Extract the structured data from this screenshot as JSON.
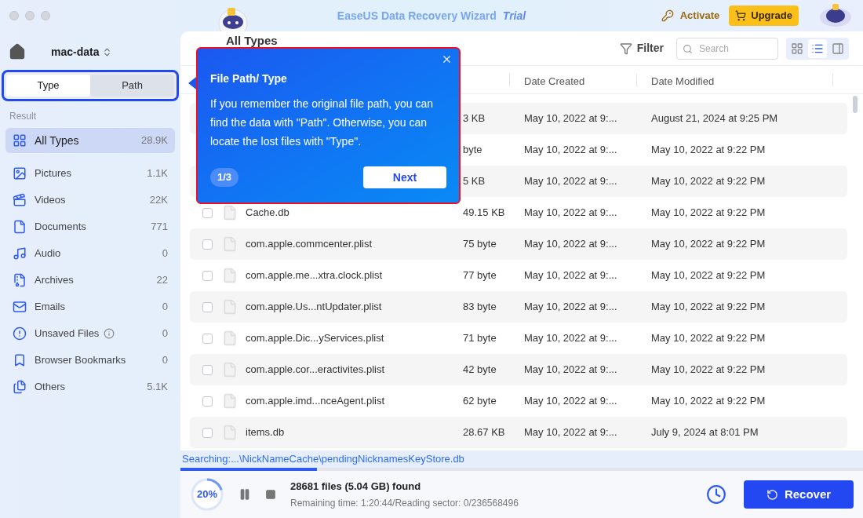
{
  "window": {
    "app_name": "EaseUS Data Recovery Wizard",
    "edition": "Trial"
  },
  "header": {
    "activate": "Activate",
    "upgrade": "Upgrade"
  },
  "sidebar": {
    "device": "mac-data",
    "tabs": [
      {
        "label": "Type",
        "selected": true
      },
      {
        "label": "Path",
        "selected": false
      }
    ],
    "section": "Result",
    "items": [
      {
        "kind": "all",
        "label": "All Types",
        "count": "28.9K",
        "selected": true,
        "info": false
      },
      {
        "kind": "pictures",
        "label": "Pictures",
        "count": "1.1K",
        "selected": false,
        "info": false
      },
      {
        "kind": "videos",
        "label": "Videos",
        "count": "22K",
        "selected": false,
        "info": false
      },
      {
        "kind": "documents",
        "label": "Documents",
        "count": "771",
        "selected": false,
        "info": false
      },
      {
        "kind": "audio",
        "label": "Audio",
        "count": "0",
        "selected": false,
        "info": false
      },
      {
        "kind": "archives",
        "label": "Archives",
        "count": "22",
        "selected": false,
        "info": false
      },
      {
        "kind": "emails",
        "label": "Emails",
        "count": "0",
        "selected": false,
        "info": false
      },
      {
        "kind": "unsaved",
        "label": "Unsaved Files",
        "count": "0",
        "selected": false,
        "info": true
      },
      {
        "kind": "bookmarks",
        "label": "Browser Bookmarks",
        "count": "0",
        "selected": false,
        "info": false
      },
      {
        "kind": "others",
        "label": "Others",
        "count": "5.1K",
        "selected": false,
        "info": false
      }
    ]
  },
  "toolbar": {
    "title": "All Types",
    "filter": "Filter",
    "search": {
      "placeholder": "Search"
    },
    "views": [
      {
        "kind": "grid",
        "selected": false
      },
      {
        "kind": "list",
        "selected": true
      },
      {
        "kind": "panel",
        "selected": false
      }
    ]
  },
  "table": {
    "columns": [
      "Date Created",
      "Date Modified"
    ],
    "rows": [
      {
        "size": "3 KB",
        "created": "May 10, 2022 at 9:...",
        "modified": "August 21, 2024 at 9:25 PM"
      },
      {
        "size": "byte",
        "created": "May 10, 2022 at 9:...",
        "modified": "May 10, 2022 at 9:22 PM"
      },
      {
        "size": "5 KB",
        "created": "May 10, 2022 at 9:...",
        "modified": "May 10, 2022 at 9:22 PM"
      },
      {
        "name": "Cache.db",
        "checked": false,
        "size": "49.15 KB",
        "created": "May 10, 2022 at 9:...",
        "modified": "May 10, 2022 at 9:22 PM"
      },
      {
        "name": "com.apple.commcenter.plist",
        "checked": false,
        "size": "75 byte",
        "created": "May 10, 2022 at 9:...",
        "modified": "May 10, 2022 at 9:22 PM"
      },
      {
        "name": "com.apple.me...xtra.clock.plist",
        "checked": false,
        "size": "77 byte",
        "created": "May 10, 2022 at 9:...",
        "modified": "May 10, 2022 at 9:22 PM"
      },
      {
        "name": "com.apple.Us...ntUpdater.plist",
        "checked": false,
        "size": "83 byte",
        "created": "May 10, 2022 at 9:...",
        "modified": "May 10, 2022 at 9:22 PM"
      },
      {
        "name": "com.apple.Dic...yServices.plist",
        "checked": false,
        "size": "71 byte",
        "created": "May 10, 2022 at 9:...",
        "modified": "May 10, 2022 at 9:22 PM"
      },
      {
        "name": "com.apple.cor...eractivites.plist",
        "checked": false,
        "size": "42 byte",
        "created": "May 10, 2022 at 9:...",
        "modified": "May 10, 2022 at 9:22 PM"
      },
      {
        "name": "com.apple.imd...nceAgent.plist",
        "checked": false,
        "size": "62 byte",
        "created": "May 10, 2022 at 9:...",
        "modified": "May 10, 2022 at 9:22 PM"
      },
      {
        "name": "items.db",
        "checked": false,
        "size": "28.67 KB",
        "created": "May 10, 2022 at 9:...",
        "modified": "July 9, 2024 at 8:01 PM"
      }
    ]
  },
  "tour": {
    "title": "File Path/ Type",
    "body": "If you remember the original file path, you can find the data with \"Path\". Otherwise, you can locate the lost files with \"Type\".",
    "step": "1/3",
    "next": "Next"
  },
  "status": {
    "searching": "Searching:...\\NickNameCache\\pendingNicknamesKeyStore.db",
    "level": 0.2,
    "percent": "20%",
    "found": "28681 files (5.04 GB) found",
    "remaining": "Remaining time: 1:20:44/Reading sector: 0/236568496",
    "recover": "Recover"
  }
}
